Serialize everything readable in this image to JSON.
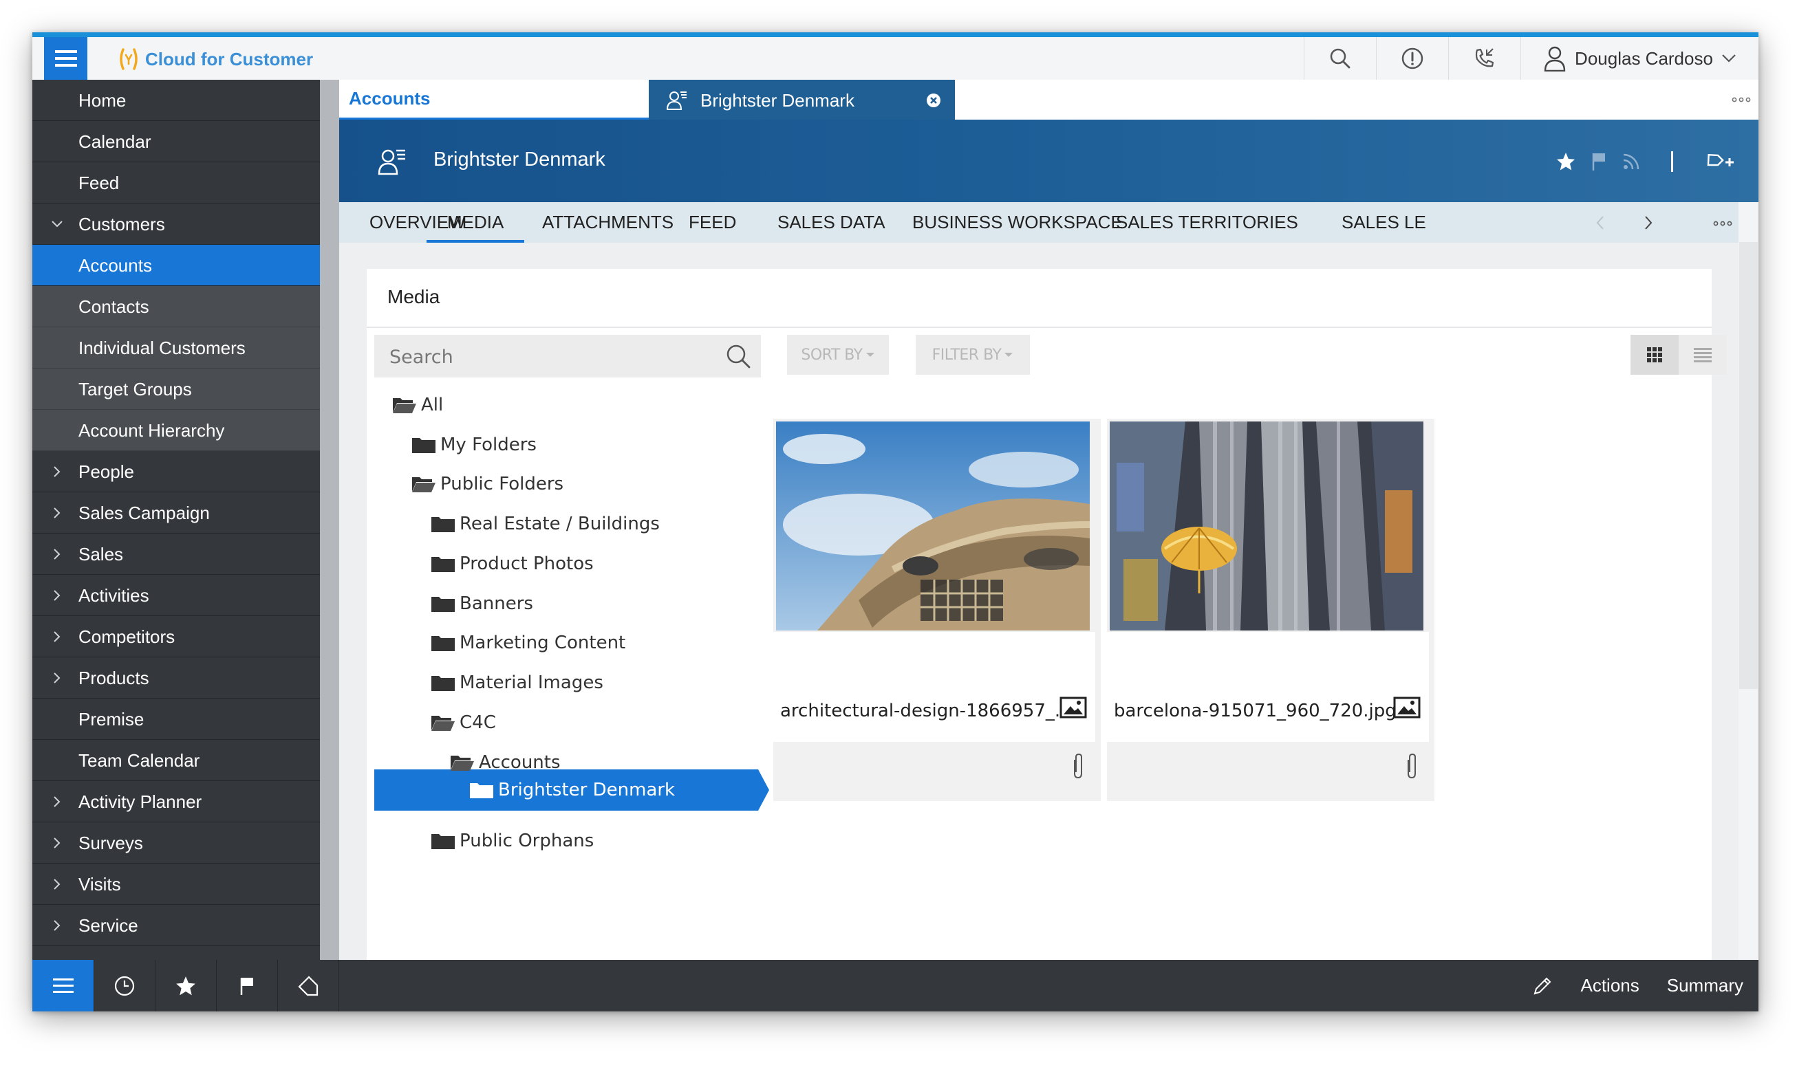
{
  "shell": {
    "app_name": "Cloud for Customer",
    "user_name": "Douglas Cardoso",
    "icons": [
      "menu-icon",
      "search-icon",
      "alert-icon",
      "phone-icon",
      "user-icon"
    ]
  },
  "sidebar": {
    "items": [
      {
        "label": "Home"
      },
      {
        "label": "Calendar"
      },
      {
        "label": "Feed"
      },
      {
        "label": "Customers"
      },
      {
        "label": "Accounts"
      },
      {
        "label": "Contacts"
      },
      {
        "label": "Individual Customers"
      },
      {
        "label": "Target Groups"
      },
      {
        "label": "Account Hierarchy"
      },
      {
        "label": "People"
      },
      {
        "label": "Sales Campaign"
      },
      {
        "label": "Sales"
      },
      {
        "label": "Activities"
      },
      {
        "label": "Competitors"
      },
      {
        "label": "Products"
      },
      {
        "label": "Premise"
      },
      {
        "label": "Team Calendar"
      },
      {
        "label": "Activity Planner"
      },
      {
        "label": "Surveys"
      },
      {
        "label": "Visits"
      },
      {
        "label": "Service"
      }
    ]
  },
  "tabs": {
    "accounts": "Accounts",
    "object_tab": "Brightster Denmark"
  },
  "header": {
    "title": "Brightster Denmark"
  },
  "subtabs": [
    "OVERVIEW",
    "MEDIA",
    "ATTACHMENTS",
    "FEED",
    "SALES DATA",
    "BUSINESS WORKSPACE",
    "SALES TERRITORIES",
    "SALES LE"
  ],
  "media": {
    "title": "Media",
    "search_placeholder": "Search",
    "sort_by": "SORT BY",
    "filter_by": "FILTER BY",
    "tree": [
      {
        "label": "All"
      },
      {
        "label": "My Folders"
      },
      {
        "label": "Public Folders"
      },
      {
        "label": "Real Estate / Buildings"
      },
      {
        "label": "Product Photos"
      },
      {
        "label": "Banners"
      },
      {
        "label": "Marketing Content"
      },
      {
        "label": "Material Images"
      },
      {
        "label": "C4C"
      },
      {
        "label": "Accounts"
      },
      {
        "label": "Brightster Denmark"
      },
      {
        "label": "Public Orphans"
      }
    ],
    "files": [
      {
        "name": "architectural-design-1866957_..."
      },
      {
        "name": "barcelona-915071_960_720.jpg"
      }
    ]
  },
  "bottombar": {
    "actions": "Actions",
    "summary": "Summary"
  },
  "colors": {
    "accent": "#1877d6",
    "sidebar": "#34383c",
    "header": "#1e5f98",
    "subtabs": "#dde8ee"
  }
}
